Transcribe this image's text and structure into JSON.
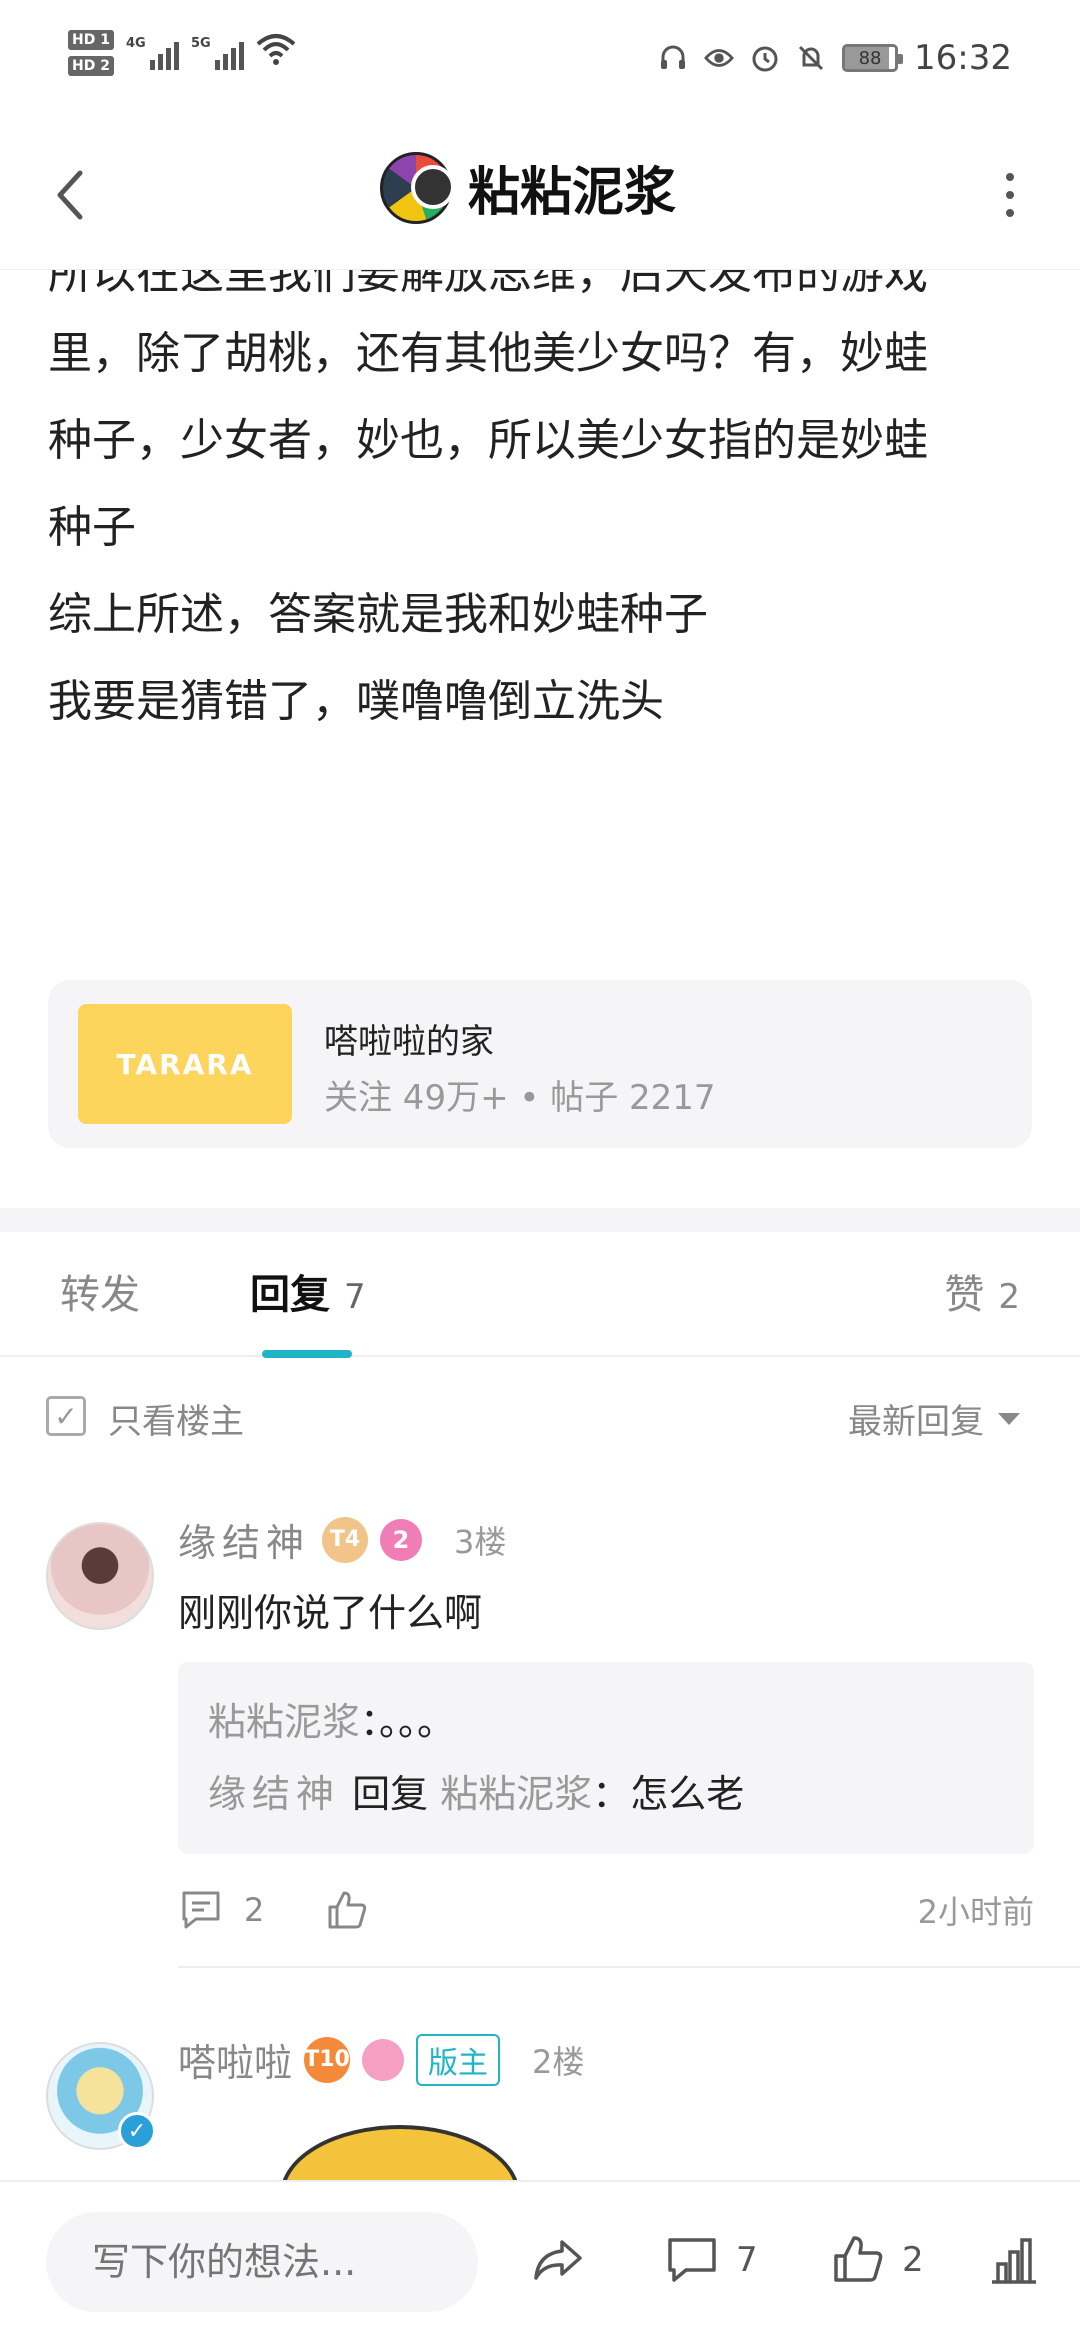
{
  "status_bar": {
    "hd1": "HD 1",
    "hd2": "HD 2",
    "net1": "4G",
    "net2": "5G",
    "battery": "88",
    "time": "16:32",
    "icons": [
      "headset-icon",
      "eye-icon",
      "alarm-icon",
      "mute-icon"
    ]
  },
  "nav": {
    "title": "粘粘泥浆"
  },
  "post": {
    "cut_line": "所以在这里我们要解放思维，后天发布的游戏",
    "lines": [
      "里，除了胡桃，还有其他美少女吗？有，妙蛙",
      "种子，少女者，妙也，所以美少女指的是妙蛙",
      "种子",
      "综上所述，答案就是我和妙蛙种子",
      "我要是猜错了，噗噜噜倒立洗头"
    ]
  },
  "forum": {
    "logo_text": "TARARA",
    "name": "嗒啦啦的家",
    "meta": "关注 49万+ • 帖子 2217",
    "logo_color": "#fdd45c"
  },
  "tabs": {
    "forward": "转发",
    "reply": "回复",
    "reply_count": "7",
    "like": "赞",
    "like_count": "2",
    "accent": "#1fb5c4"
  },
  "filter": {
    "only_op": "只看楼主",
    "sort": "最新回复"
  },
  "comments": [
    {
      "name": "缘结神",
      "level": "T4",
      "badge": "2",
      "floor": "3楼",
      "text": "刚刚你说了什么啊",
      "quote_line1_author": "粘粘泥浆",
      "quote_line1_text": "：。。。",
      "quote_line2_author": "缘结神",
      "quote_line2_reply": "回复",
      "quote_line2_target": "粘粘泥浆",
      "quote_line2_text": "：怎么老",
      "reply_count": "2",
      "time": "2小时前"
    },
    {
      "name": "嗒啦啦",
      "level": "T10",
      "mod_badge": "版主",
      "floor": "2楼"
    }
  ],
  "bottom": {
    "placeholder": "写下你的想法...",
    "comment_count": "7",
    "like_count": "2"
  }
}
